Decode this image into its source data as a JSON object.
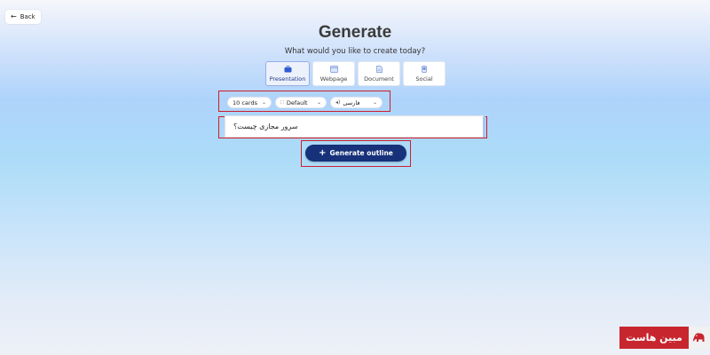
{
  "nav": {
    "back_label": "Back"
  },
  "header": {
    "title": "Generate",
    "subtitle": "What would you like to create today?"
  },
  "types": [
    {
      "label": "Presentation",
      "icon": "presentation-icon",
      "selected": true
    },
    {
      "label": "Webpage",
      "icon": "webpage-icon",
      "selected": false
    },
    {
      "label": "Document",
      "icon": "document-icon",
      "selected": false
    },
    {
      "label": "Social",
      "icon": "social-icon",
      "selected": false
    }
  ],
  "options": {
    "cards": "10 cards",
    "theme": "Default",
    "language": "فارسی"
  },
  "prompt": {
    "value": "سرور مجازی چیست؟"
  },
  "actions": {
    "generate_label": "Generate outline"
  },
  "brand": {
    "text": "مبین هاست"
  },
  "colors": {
    "accent": "#17317a",
    "highlight_border": "#cc1f2b",
    "selected_card": "#edf1fb",
    "brand_red": "#c8262f"
  }
}
